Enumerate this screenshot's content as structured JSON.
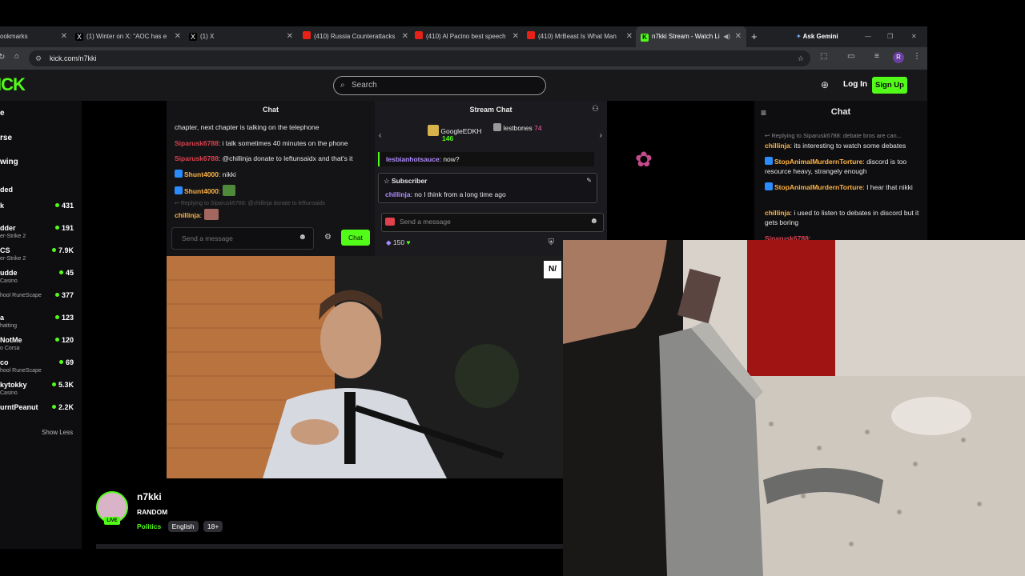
{
  "browser": {
    "tabs": [
      {
        "label": "ookmarks",
        "favicon_color": "#000000"
      },
      {
        "label": "(1) Winter on X: \"AOC has e",
        "favicon_color": "#000000"
      },
      {
        "label": "(1) X",
        "favicon_color": "#000000"
      },
      {
        "label": "(410) Russia Counterattacks",
        "favicon_color": "#ff0000"
      },
      {
        "label": "(410) Al Pacino best speech",
        "favicon_color": "#ff0000"
      },
      {
        "label": "(410) MrBeast Is What Man",
        "favicon_color": "#ff0000"
      },
      {
        "label": "n7kki Stream - Watch Li",
        "favicon_color": "#53fc18"
      }
    ],
    "ask_gemini": "Ask Gemini",
    "url": "kick.com/n7kki",
    "profile_initial": "R"
  },
  "site": {
    "logo": "ICK",
    "search_placeholder": "Search",
    "login": "Log In",
    "signup": "Sign Up",
    "accent": "#53fc18"
  },
  "sidebar": {
    "nav": [
      "e",
      "rse",
      "wing"
    ],
    "section": "ded",
    "channels": [
      {
        "name": "k",
        "sub": "",
        "count": "431"
      },
      {
        "name": "dder",
        "sub": "er-Strike 2",
        "count": "191"
      },
      {
        "name": "CS",
        "sub": "er-Strike 2",
        "count": "7.9K"
      },
      {
        "name": "udde",
        "sub": "Casino",
        "count": "45"
      },
      {
        "name": "",
        "sub": "hool RuneScape",
        "count": "377"
      },
      {
        "name": "a",
        "sub": "hatting",
        "count": "123"
      },
      {
        "name": "NotMe",
        "sub": "o Corsa",
        "count": "120"
      },
      {
        "name": "co",
        "sub": "hool RuneScape",
        "count": "69"
      },
      {
        "name": "kytokky",
        "sub": "Casino",
        "count": "5.3K"
      },
      {
        "name": "urntPeanut",
        "sub": "",
        "count": "2.2K"
      }
    ],
    "show_less": "Show Less"
  },
  "embedded_chat": {
    "title": "Chat",
    "messages": [
      {
        "user": "",
        "text": "chapter, next chapter is talking on the telephone"
      },
      {
        "user": "Siparusk6788",
        "text": ": i talk sometimes 40 minutes on the phone"
      },
      {
        "user": "Siparusk6788",
        "text": ": @chillinja donate to leftunsaidx and that's it"
      },
      {
        "user": "Shunt4000",
        "text": ": nikki"
      },
      {
        "user": "Shunt4000",
        "text": ":"
      },
      {
        "user": "",
        "text": "Replying to Siparusk6788: @chillinja donate to leftunsaidx"
      },
      {
        "user": "chillinja",
        "text": ":"
      }
    ],
    "input_placeholder": "Send a message",
    "send_label": "Chat"
  },
  "stream_chat": {
    "title": "Stream Chat",
    "gifters": [
      {
        "name": "GoogleEDKH",
        "count": "146"
      },
      {
        "name": "lestbones",
        "count": "74"
      }
    ],
    "line1_user": "lesbianhotsauce",
    "line1_text": ": now?",
    "subscriber_label": "Subscriber",
    "line2_user": "chillinja",
    "line2_text": ": no I think from a long time ago",
    "input_placeholder": "Send a message",
    "points": "150"
  },
  "right_chat": {
    "title": "Chat",
    "messages": [
      {
        "user": "",
        "text": "Replying to Siparusk6788: debate bros are can..."
      },
      {
        "user": "chillinja",
        "text": ": its interesting to watch some debates"
      },
      {
        "user": "StopAnimalMurdernTorture",
        "text": ": discord is too resource heavy, strangely enough"
      },
      {
        "user": "StopAnimalMurdernTorture",
        "text": ": I hear that nikki"
      },
      {
        "user": "chillinja",
        "text": ": i used to listen to debates in discord but it gets boring"
      },
      {
        "user": "Siparusk6788",
        "text": ":"
      }
    ]
  },
  "channel": {
    "name": "n7kki",
    "category": "RANDOM",
    "live": "LIVE",
    "tags": [
      "Politics",
      "English",
      "18+"
    ]
  }
}
